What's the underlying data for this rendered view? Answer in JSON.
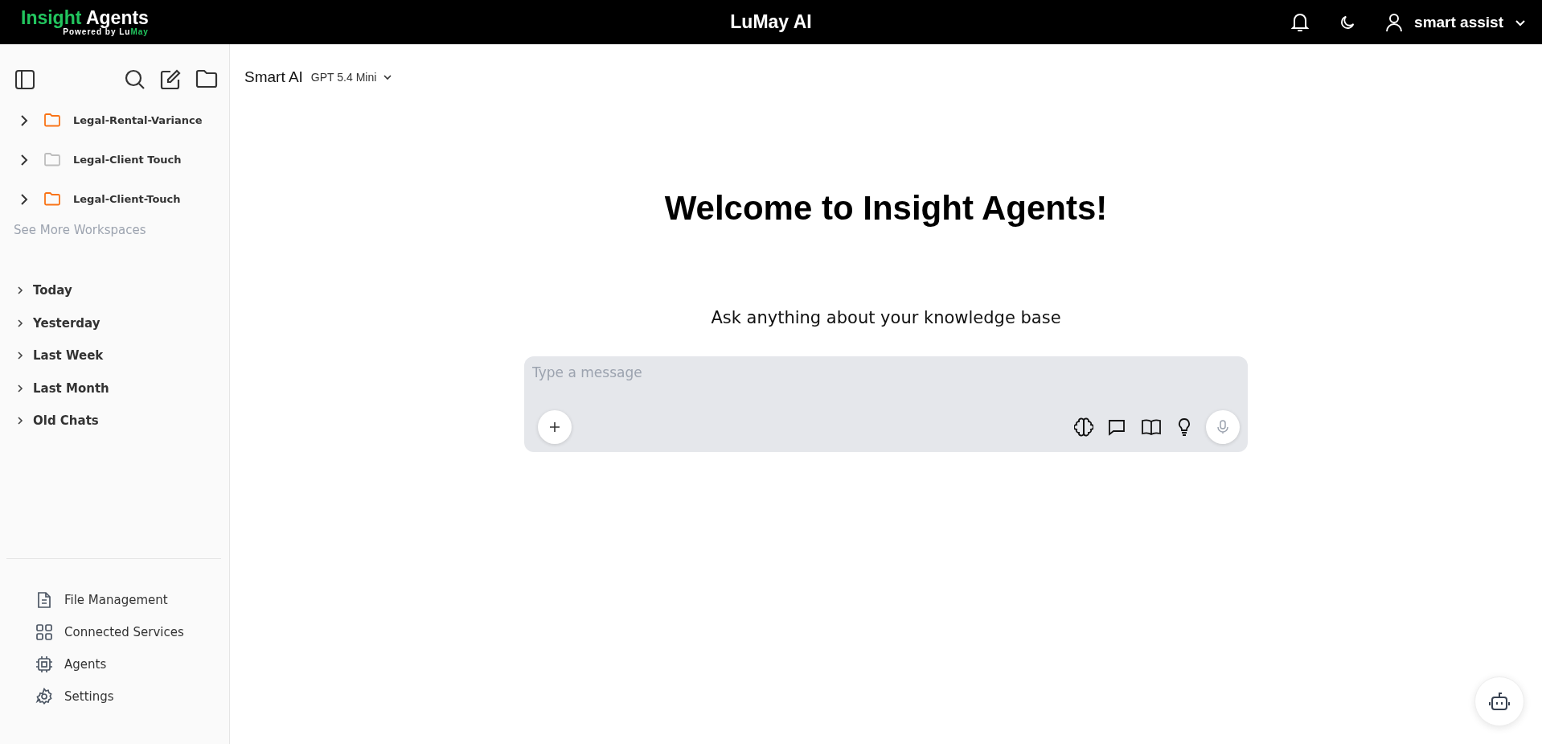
{
  "header": {
    "logo": {
      "title": [
        {
          "text": "Insight",
          "color": "#22c55e"
        },
        {
          "text": " Agents",
          "color": "#ffffff"
        }
      ],
      "subtitle": [
        {
          "text": "Powered by Lu",
          "color": "#ffffff"
        },
        {
          "text": "May",
          "color": "#22c55e"
        }
      ]
    },
    "title": "LuMay AI",
    "user": "smart assist"
  },
  "sidebar": {
    "workspaces": [
      {
        "name": "Legal-Rental-Variance",
        "color": "#f97316"
      },
      {
        "name": "Legal-Client Touch",
        "color": "#bdbdbd"
      },
      {
        "name": "Legal-Client-Touch",
        "color": "#f97316"
      }
    ],
    "see_more": "See More Workspaces",
    "history": [
      {
        "label": "Today",
        "expanded": false
      },
      {
        "label": "Yesterday",
        "expanded": false
      },
      {
        "label": "Last Week",
        "expanded": false
      },
      {
        "label": "Last Month",
        "expanded": false
      },
      {
        "label": "Old Chats",
        "expanded": false
      }
    ],
    "nav": [
      {
        "label": "File Management",
        "kind": "file"
      },
      {
        "label": "Connected Services",
        "kind": "grid"
      },
      {
        "label": "Agents",
        "kind": "chip"
      },
      {
        "label": "Settings",
        "kind": "gear"
      }
    ]
  },
  "main": {
    "assistant": "Smart AI",
    "model": "GPT 5.4 Mini",
    "welcome": "Welcome to Insight Agents!",
    "prompt": "Ask anything about your knowledge base",
    "composer": {
      "placeholder": "Type a message"
    }
  }
}
